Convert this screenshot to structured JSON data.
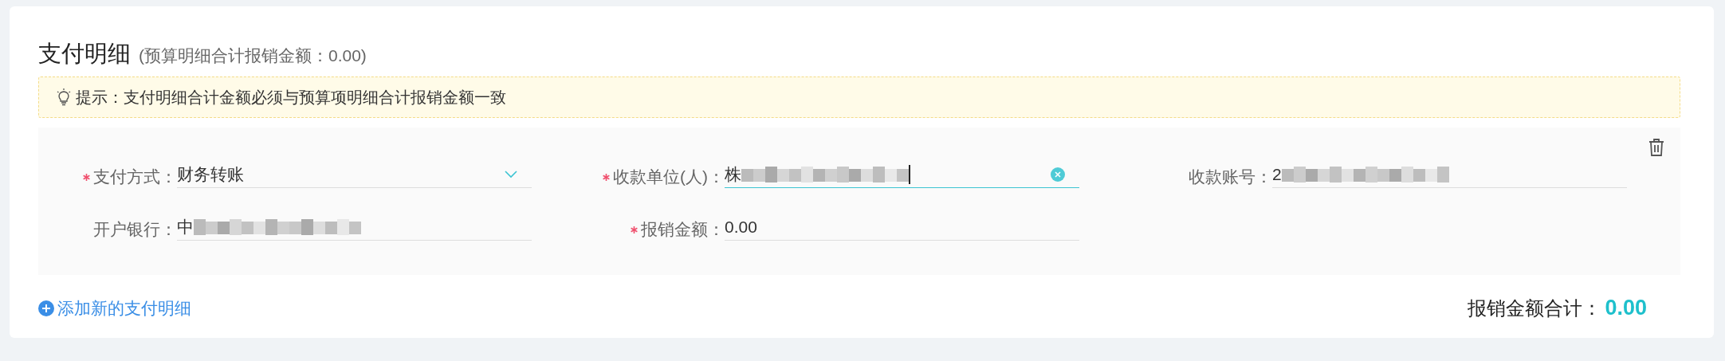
{
  "title": "支付明细",
  "subtitle": "(预算明细合计报销金额：0.00)",
  "notice": {
    "text": "提示：支付明细合计金额必须与预算项明细合计报销金额一致"
  },
  "payments": [
    {
      "fields": [
        {
          "label": "支付方式：",
          "required": true,
          "value": "财务转账",
          "kind": "select",
          "focused": false,
          "masked": false
        },
        {
          "label": "收款单位(人)：",
          "required": true,
          "value": "株",
          "kind": "text",
          "focused": true,
          "masked": true
        },
        {
          "label": "收款账号：",
          "required": false,
          "value": "2",
          "kind": "text",
          "focused": false,
          "masked": true
        },
        {
          "label": "开户银行：",
          "required": false,
          "value": "中",
          "kind": "text",
          "focused": false,
          "masked": true
        },
        {
          "label": "报销金额：",
          "required": true,
          "value": "0.00",
          "kind": "text",
          "focused": false,
          "masked": false
        }
      ]
    }
  ],
  "add_link": "添加新的支付明细",
  "total": {
    "label": "报销金额合计：",
    "value": "0.00"
  }
}
